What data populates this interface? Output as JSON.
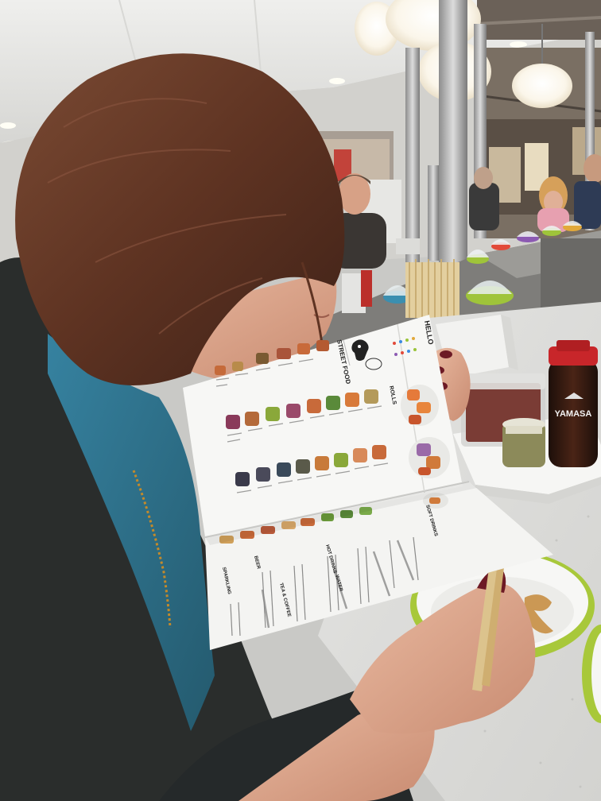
{
  "photo": {
    "subject": "woman-reading-menu-at-sushi-conveyor-restaurant",
    "colors": {
      "ceiling": "#e9e9e7",
      "counter": "#e8e8e6",
      "hair": "#6a3b26",
      "cardigan": "#2a2d2c",
      "shirt": "#2f7088",
      "skin": "#e2ac92",
      "menu_paper": "#f4f4f2",
      "plate_rim": "#a8c83a",
      "soy_cap": "#c8262a",
      "chopsticks": "#d9c08a"
    }
  },
  "menu": {
    "title": "HELLO",
    "section_street_food": "STREET FOOD",
    "section_rolls": "ROLLS",
    "section_soft_drinks": "SOFT DRINKS",
    "section_beer": "BEER",
    "section_sparkling": "SPARKLING",
    "section_hot_drinks": "HOT DRINKS",
    "section_water": "WATER",
    "section_tea_coffee": "TEA & COFFEE"
  },
  "soy_bottle": {
    "brand": "YAMASA"
  }
}
